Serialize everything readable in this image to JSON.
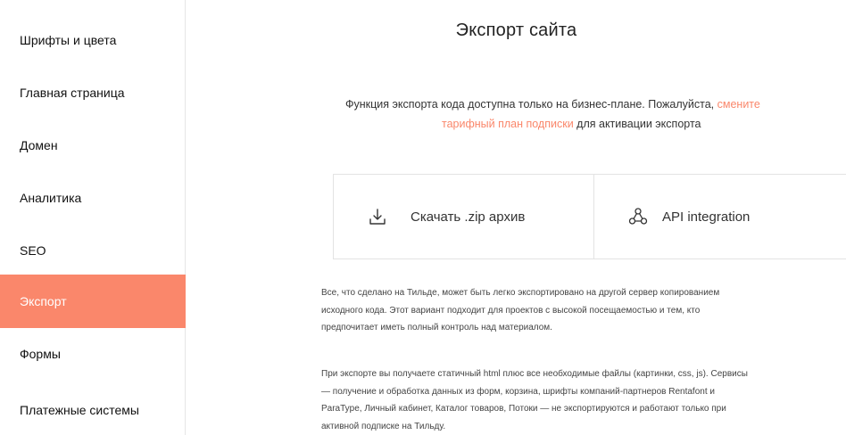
{
  "sidebar": {
    "items": [
      {
        "label": "Шрифты и цвета",
        "active": false
      },
      {
        "label": "Главная страница",
        "active": false
      },
      {
        "label": "Домен",
        "active": false
      },
      {
        "label": "Аналитика",
        "active": false
      },
      {
        "label": "SEO",
        "active": false
      },
      {
        "label": "Экспорт",
        "active": true
      },
      {
        "label": "Формы",
        "active": false
      },
      {
        "label": "Платежные системы",
        "active": false
      }
    ]
  },
  "main": {
    "title": "Экспорт сайта",
    "notice": {
      "text_before": "Функция экспорта кода доступна только на бизнес-плане. Пожалуйста, ",
      "link_part1": "смените",
      "link_part2": "тарифный план подписки",
      "text_after": " для активации экспорта"
    },
    "options": {
      "zip": {
        "label": "Скачать .zip архив",
        "icon": "download-icon"
      },
      "api": {
        "label": "API integration",
        "icon": "api-integration-icon"
      }
    },
    "paragraph1": [
      "Все, что сделано на Тильде, может быть легко экспортировано на другой сервер копированием",
      "исходного кода. Этот вариант подходит для проектов с высокой посещаемостью и тем, кто",
      "предпочитает иметь полный контроль над материалом."
    ],
    "paragraph2": [
      "При экспорте вы получаете статичный html плюс все необходимые файлы (картинки, css, js). Сервисы",
      "— получение и обработка данных из форм, корзина, шрифты компаний-партнеров Rentafont и",
      "ParaType, Личный кабинет, Каталог товаров, Потоки — не экспортируются и работают только при",
      "активной подписке на Тильду."
    ]
  },
  "colors": {
    "accent": "#fa876b",
    "border": "#e3e3e3"
  }
}
